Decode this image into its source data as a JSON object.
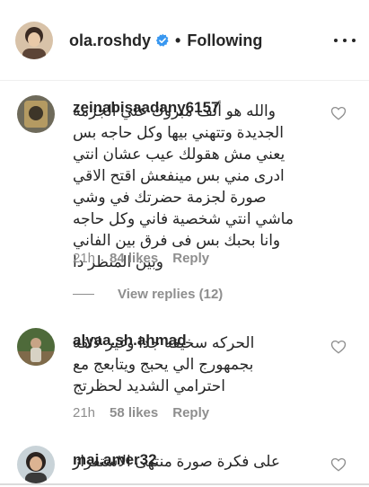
{
  "header": {
    "username": "ola.roshdy",
    "separator": "•",
    "follow_state": "Following",
    "icons": {
      "avatar": "profile-photo",
      "verified": "verified-badge-icon",
      "more": "more-options-icon"
    },
    "colors": {
      "verified": "#3897f0",
      "text": "#262626",
      "muted": "#8e8e8e"
    }
  },
  "comments": [
    {
      "username": "zeinabisaadany6157",
      "text": "والله هو ألف مبروك علي الجزمة الجديدة وتتهني بيها وكل حاجه بس يعني مش هقولك عيب عشان انتي ادرى مني بس مينفعش اقتح الاقي صورة لجزمة حضرتك في وشي ماشي انتي شخصية فاني وكل حاجه وانا بحبك بس فى فرق بين الفاني وبين المنظر دا",
      "time": "21h",
      "likes": "84 likes",
      "reply": "Reply",
      "view_replies": "View replies (12)"
    },
    {
      "username": "alyaa.sh.ahmad",
      "text": "الحركه سخيفه جدا وغير لائقة بجمهورج الي يحبج ويتابعج مع احترامي الشديد لحظرتج",
      "time": "21h",
      "likes": "58 likes",
      "reply": "Reply"
    },
    {
      "username": "mai.amer32",
      "text": "على فكرة صورة منتهى الاستفزاز"
    }
  ]
}
